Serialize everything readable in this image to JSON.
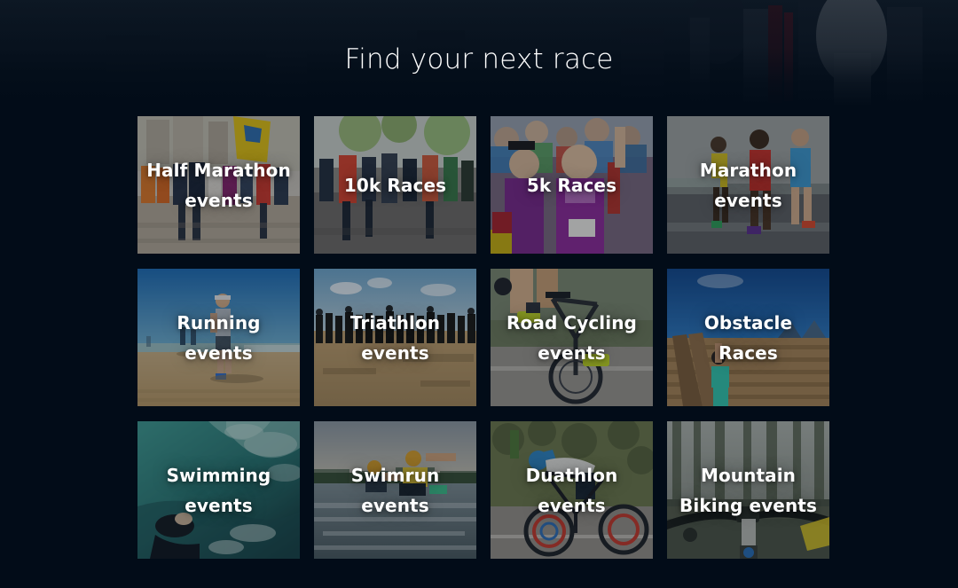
{
  "page": {
    "background_color": "#020c18",
    "title": "Find your next race",
    "title_color": "#ffffff"
  },
  "grid": {
    "columns": 4,
    "rows": 3,
    "tiles": [
      {
        "label": "Half Marathon events",
        "icon": "half-marathon-photo",
        "theme": "street-race",
        "sky": "#c9c6bd",
        "ground": "#b9ae9d",
        "accent": "#e8c21c"
      },
      {
        "label": "10k Races",
        "icon": "10k-races-photo",
        "theme": "road-runners",
        "sky": "#cfd6cf",
        "ground": "#8e8c86",
        "accent": "#d8452f"
      },
      {
        "label": "5k Races",
        "icon": "5k-races-photo",
        "theme": "crowd-finish",
        "sky": "#b9bec6",
        "ground": "#6e5a78",
        "accent": "#7a2a8c"
      },
      {
        "label": "Marathon events",
        "icon": "marathon-photo",
        "theme": "elite-road",
        "sky": "#9b9f9e",
        "ground": "#6b6e70",
        "accent": "#c8352c"
      },
      {
        "label": "Running events",
        "icon": "running-photo",
        "theme": "beach-runner",
        "sky": "#2f7fc4",
        "ground": "#c9a96c",
        "accent": "#ffffff"
      },
      {
        "label": "Triathlon events",
        "icon": "triathlon-photo",
        "theme": "beach-start",
        "sky": "#7fb3d8",
        "ground": "#c2a271",
        "accent": "#241c14"
      },
      {
        "label": "Road Cycling events",
        "icon": "road-cycling-photo",
        "theme": "cyclist-road",
        "sky": "#8a8f82",
        "ground": "#8d8d86",
        "accent": "#c6dc28"
      },
      {
        "label": "Obstacle Races",
        "icon": "obstacle-races-photo",
        "theme": "wall-climb",
        "sky": "#1f5fa8",
        "ground": "#a98659",
        "accent": "#35c8b0"
      },
      {
        "label": "Swimming events",
        "icon": "swimming-photo",
        "theme": "open-water",
        "sky": "#2e7b78",
        "ground": "#1d4a4d",
        "accent": "#bfe3de"
      },
      {
        "label": "Swimrun events",
        "icon": "swimrun-photo",
        "theme": "lake-swimrun",
        "sky": "#9aa6ad",
        "ground": "#5d6f74",
        "accent": "#e3c83a"
      },
      {
        "label": "Duathlon events",
        "icon": "duathlon-photo",
        "theme": "tt-bike-hill",
        "sky": "#6e7a4e",
        "ground": "#8d8778",
        "accent": "#1f6fae"
      },
      {
        "label": "Mountain Biking events",
        "icon": "mountain-biking-photo",
        "theme": "forest-mtb",
        "sky": "#9aa29c",
        "ground": "#4d5548",
        "accent": "#d8c427"
      }
    ]
  }
}
